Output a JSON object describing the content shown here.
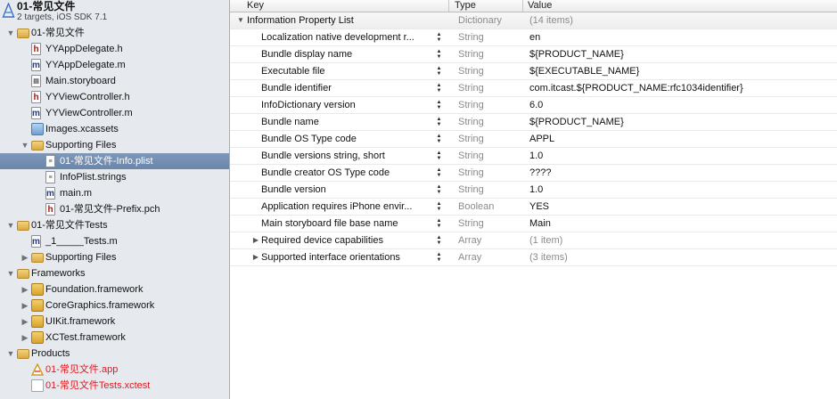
{
  "navigator": {
    "project": {
      "name": "01-常见文件",
      "subtitle": "2 targets, iOS SDK 7.1",
      "icon": "xcode-project-icon"
    },
    "items": [
      {
        "label": "01-常见文件",
        "icon": "folder",
        "level": 1,
        "disclosure": "open"
      },
      {
        "label": "YYAppDelegate.h",
        "icon": "header-file",
        "level": 2
      },
      {
        "label": "YYAppDelegate.m",
        "icon": "implementation-file",
        "level": 2
      },
      {
        "label": "Main.storyboard",
        "icon": "storyboard-file",
        "level": 2
      },
      {
        "label": "YYViewController.h",
        "icon": "header-file",
        "level": 2
      },
      {
        "label": "YYViewController.m",
        "icon": "implementation-file",
        "level": 2
      },
      {
        "label": "Images.xcassets",
        "icon": "asset-catalog",
        "level": 2
      },
      {
        "label": "Supporting Files",
        "icon": "folder",
        "level": 2,
        "disclosure": "open"
      },
      {
        "label": "01-常见文件-Info.plist",
        "icon": "plist-file",
        "level": 3,
        "selected": true
      },
      {
        "label": "InfoPlist.strings",
        "icon": "strings-file",
        "level": 3
      },
      {
        "label": "main.m",
        "icon": "implementation-file",
        "level": 3
      },
      {
        "label": "01-常见文件-Prefix.pch",
        "icon": "pch-file",
        "level": 3
      },
      {
        "label": "01-常见文件Tests",
        "icon": "folder",
        "level": 1,
        "disclosure": "open"
      },
      {
        "label": "_1_____Tests.m",
        "icon": "implementation-file",
        "level": 2
      },
      {
        "label": "Supporting Files",
        "icon": "folder",
        "level": 2,
        "disclosure": "closed"
      },
      {
        "label": "Frameworks",
        "icon": "folder",
        "level": 1,
        "disclosure": "open"
      },
      {
        "label": "Foundation.framework",
        "icon": "framework",
        "level": 2,
        "disclosure": "closed"
      },
      {
        "label": "CoreGraphics.framework",
        "icon": "framework",
        "level": 2,
        "disclosure": "closed"
      },
      {
        "label": "UIKit.framework",
        "icon": "framework",
        "level": 2,
        "disclosure": "closed"
      },
      {
        "label": "XCTest.framework",
        "icon": "framework",
        "level": 2,
        "disclosure": "closed"
      },
      {
        "label": "Products",
        "icon": "folder",
        "level": 1,
        "disclosure": "open"
      },
      {
        "label": "01-常见文件.app",
        "icon": "app-product",
        "level": 2,
        "missing": true
      },
      {
        "label": "01-常见文件Tests.xctest",
        "icon": "test-product",
        "level": 2,
        "missing": true
      }
    ]
  },
  "editor": {
    "columns": {
      "key": "Key",
      "type": "Type",
      "value": "Value"
    },
    "rows": [
      {
        "key": "Information Property List",
        "type": "Dictionary",
        "value": "(14 items)",
        "level": 0,
        "disclosure": "open",
        "value_dim": true
      },
      {
        "key": "Localization native development r...",
        "type": "String",
        "value": "en",
        "level": 1
      },
      {
        "key": "Bundle display name",
        "type": "String",
        "value": "${PRODUCT_NAME}",
        "level": 1
      },
      {
        "key": "Executable file",
        "type": "String",
        "value": "${EXECUTABLE_NAME}",
        "level": 1
      },
      {
        "key": "Bundle identifier",
        "type": "String",
        "value": "com.itcast.${PRODUCT_NAME:rfc1034identifier}",
        "level": 1
      },
      {
        "key": "InfoDictionary version",
        "type": "String",
        "value": "6.0",
        "level": 1
      },
      {
        "key": "Bundle name",
        "type": "String",
        "value": "${PRODUCT_NAME}",
        "level": 1
      },
      {
        "key": "Bundle OS Type code",
        "type": "String",
        "value": "APPL",
        "level": 1
      },
      {
        "key": "Bundle versions string, short",
        "type": "String",
        "value": "1.0",
        "level": 1
      },
      {
        "key": "Bundle creator OS Type code",
        "type": "String",
        "value": "????",
        "level": 1
      },
      {
        "key": "Bundle version",
        "type": "String",
        "value": "1.0",
        "level": 1
      },
      {
        "key": "Application requires iPhone envir...",
        "type": "Boolean",
        "value": "YES",
        "level": 1
      },
      {
        "key": "Main storyboard file base name",
        "type": "String",
        "value": "Main",
        "level": 1
      },
      {
        "key": "Required device capabilities",
        "type": "Array",
        "value": "(1 item)",
        "level": 1,
        "disclosure": "closed",
        "value_dim": true
      },
      {
        "key": "Supported interface orientations",
        "type": "Array",
        "value": "(3 items)",
        "level": 1,
        "disclosure": "closed",
        "value_dim": true
      }
    ]
  },
  "colors": {
    "selection": "#7590b4",
    "missing_file": "#e0191f",
    "sidebar_bg": "#e6e9ee",
    "type_text": "#8b8b8b"
  }
}
